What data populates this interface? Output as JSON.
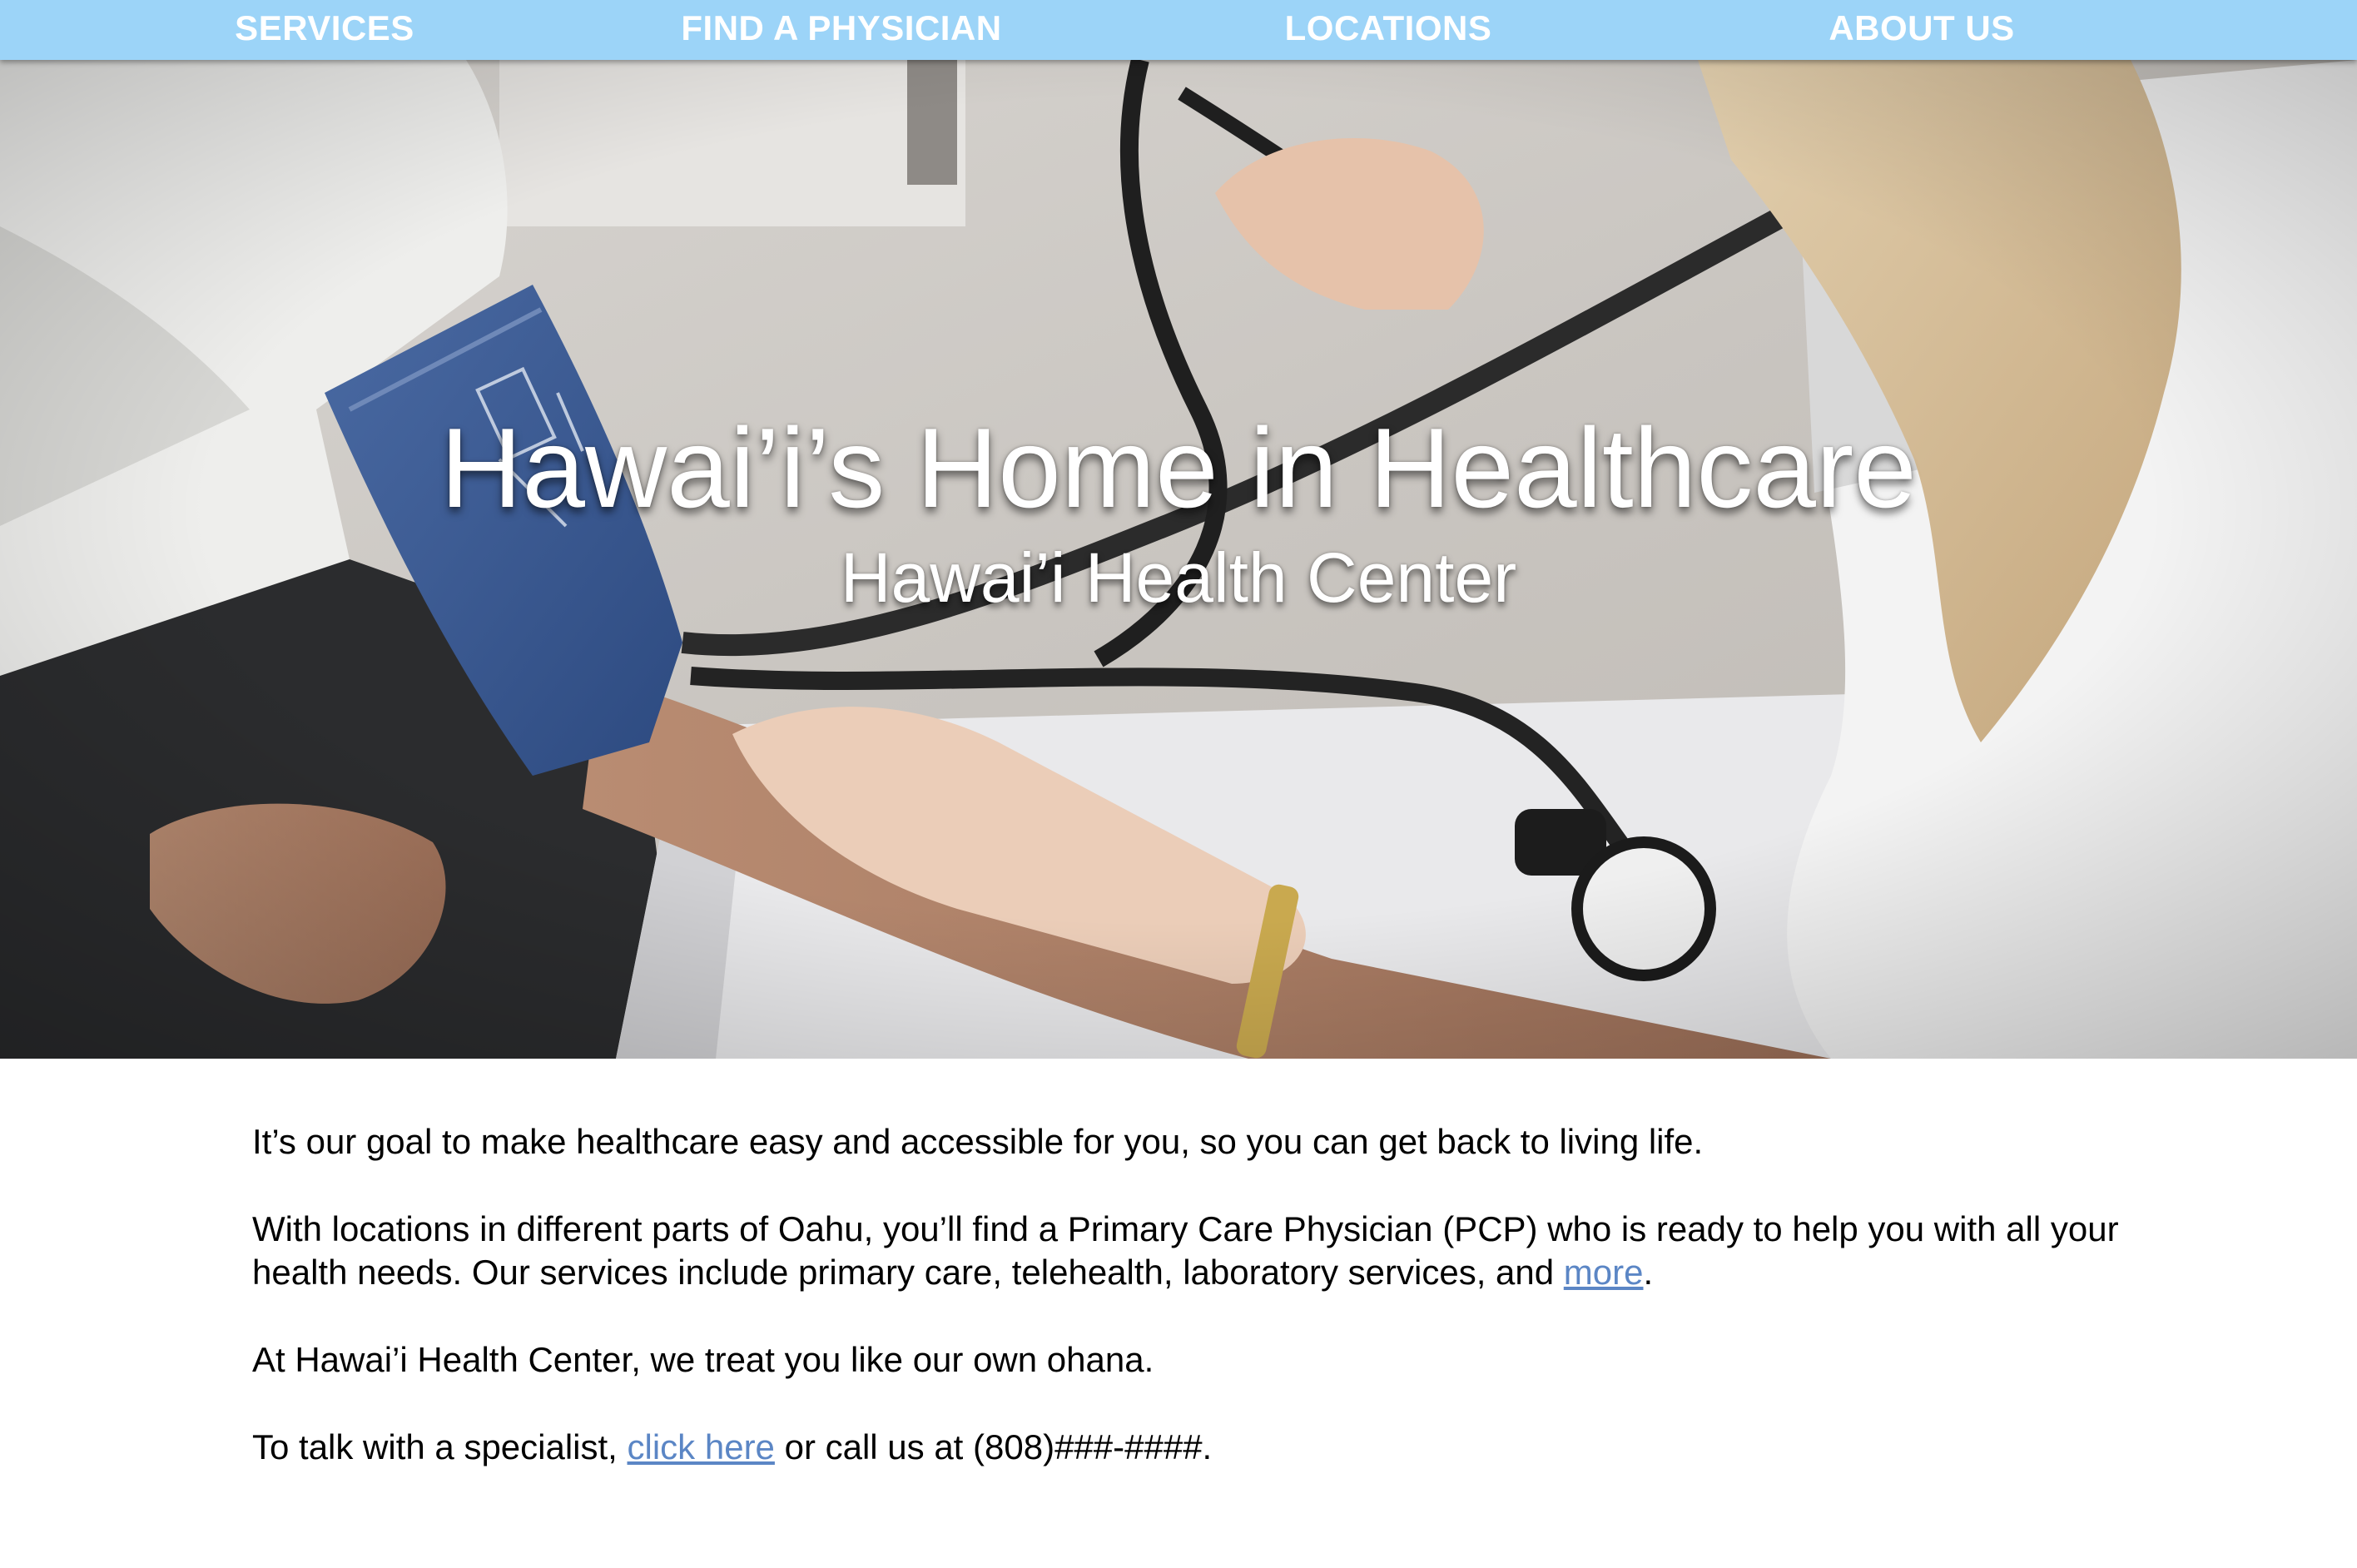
{
  "nav": {
    "items": [
      {
        "label": "SERVICES"
      },
      {
        "label": "FIND A PHYSICIAN"
      },
      {
        "label": "LOCATIONS"
      },
      {
        "label": "ABOUT US"
      }
    ]
  },
  "hero": {
    "title": "Hawai’i’s Home in Healthcare",
    "subtitle": "Hawai’i Health Center",
    "image": "blood-pressure-measurement-photo"
  },
  "content": {
    "p1": "It’s our goal to make healthcare easy and accessible for you, so you can get back to living life.",
    "p2_text": "With locations in different parts of Oahu, you’ll find a Primary Care Physician (PCP) who is ready to help you with all your health needs. Our services include primary care, telehealth, laboratory services, and ",
    "p2_link": "more",
    "p2_end": ".",
    "p3": "At Hawai’i Health Center, we treat you like our own ohana.",
    "p4_text": "To talk with a specialist, ",
    "p4_link": "click here",
    "p4_end": " or call us at (808)###-####."
  },
  "colors": {
    "nav_bg": "#9cd4f8",
    "link": "#5b86c5",
    "text": "#000000"
  }
}
